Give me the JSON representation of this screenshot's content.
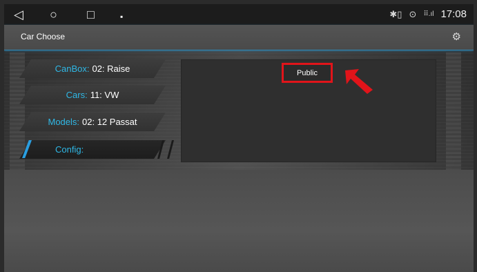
{
  "statusbar": {
    "nav": {
      "back": "◁",
      "home": "○",
      "recents": "□",
      "notify": "▪"
    },
    "icons": [
      "bluetooth-icon",
      "location-icon",
      "signal-icon"
    ],
    "glyphs": {
      "bluetooth": "✱▯",
      "location": "⊙",
      "signal": "⠿.ıl"
    },
    "time": "17:08"
  },
  "header": {
    "title": "Car Choose",
    "settings_icon": "⚙"
  },
  "options": [
    {
      "key": "CanBox:",
      "value": "02: Raise"
    },
    {
      "key": "Cars:",
      "value": "11: VW"
    },
    {
      "key": "Models:",
      "value": "02: 12 Passat"
    },
    {
      "key": "Config:",
      "value": ""
    }
  ],
  "panel": {
    "items": [
      {
        "label": "Public"
      }
    ]
  },
  "colors": {
    "accent": "#2fb8e6",
    "highlight": "#e1141a"
  }
}
